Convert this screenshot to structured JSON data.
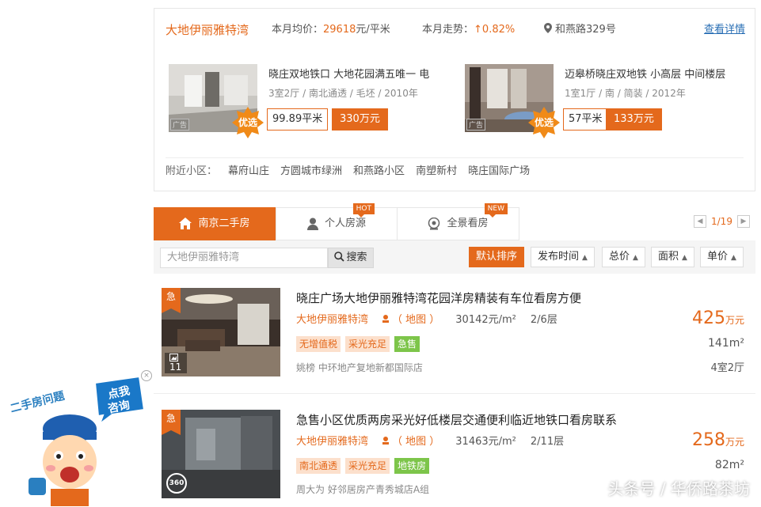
{
  "community": {
    "name": "大地伊丽雅特湾",
    "avg_label": "本月均价：",
    "avg_price": "29618",
    "avg_unit": "元/平米",
    "trend_label": "本月走势：",
    "trend_arrow": "↑",
    "trend_value": "0.82%",
    "address": "和燕路329号",
    "detail_link": "查看详情"
  },
  "featured": [
    {
      "title": "晓庄双地铁口 大地花园满五唯一 电",
      "info": "3室2厅 / 南北通透 / 毛坯 / 2010年",
      "badge": "优选",
      "ad": "广告",
      "size": "99.89平米",
      "price": "330万元"
    },
    {
      "title": "迈皋桥晓庄双地铁 小高层 中间楼层",
      "info": "1室1厅 / 南 / 简装 / 2012年",
      "badge": "优选",
      "ad": "广告",
      "size": "57平米",
      "price": "133万元"
    }
  ],
  "nearby": {
    "label": "附近小区：",
    "items": [
      "幕府山庄",
      "方圆城市绿洲",
      "和燕路小区",
      "南塑新村",
      "晓庄国际广场"
    ]
  },
  "tabs": [
    {
      "label": "南京二手房",
      "active": true,
      "icon": "home-icon"
    },
    {
      "label": "个人房源",
      "badge": "HOT",
      "icon": "person-icon"
    },
    {
      "label": "全景看房",
      "badge": "NEW",
      "icon": "camera-icon"
    }
  ],
  "pager": {
    "prev": "◀",
    "text": "1/19",
    "next": "▶"
  },
  "search": {
    "value": "大地伊丽雅特湾",
    "button": "搜索"
  },
  "sorts": [
    {
      "label": "默认排序",
      "active": true
    },
    {
      "label": "发布时间",
      "arrow": "▲"
    },
    {
      "label": "总价",
      "arrow": "▲"
    },
    {
      "label": "面积",
      "arrow": "▲"
    },
    {
      "label": "单价",
      "arrow": "▲"
    }
  ],
  "listings": [
    {
      "title": "晓庄广场大地伊丽雅特湾花园洋房精装有车位看房方便",
      "community": "大地伊丽雅特湾",
      "map": "（ 地图 ）",
      "unit_price": "30142元/m²",
      "floor": "2/6层",
      "tags": [
        {
          "text": "无增值税",
          "style": "orange"
        },
        {
          "text": "采光充足",
          "style": "orange"
        },
        {
          "text": "急售",
          "style": "green"
        }
      ],
      "agent": "姚榜  中环地产复地新都国际店",
      "price": "425",
      "price_unit": "万元",
      "area": "141m²",
      "rooms": "4室2厅",
      "urgent": "急",
      "photo_count": "11"
    },
    {
      "title": "急售小区优质两房采光好低楼层交通便利临近地铁口看房联系",
      "community": "大地伊丽雅特湾",
      "map": "（ 地图 ）",
      "unit_price": "31463元/m²",
      "floor": "2/11层",
      "tags": [
        {
          "text": "南北通透",
          "style": "orange"
        },
        {
          "text": "采光充足",
          "style": "orange"
        },
        {
          "text": "地铁房",
          "style": "green"
        }
      ],
      "agent": "周大为  好邻居房产青秀城店A组",
      "price": "258",
      "price_unit": "万元",
      "area": "82m²",
      "urgent": "急",
      "pano": "360"
    }
  ],
  "mascot": {
    "question": "二手房问题",
    "consult": [
      "点我",
      "咨询"
    ],
    "close": "×"
  },
  "watermark": "头条号 / 华侨路茶坊",
  "colors": {
    "accent": "#e4691c",
    "green": "#7dc54a",
    "link": "#2a6fb5"
  }
}
